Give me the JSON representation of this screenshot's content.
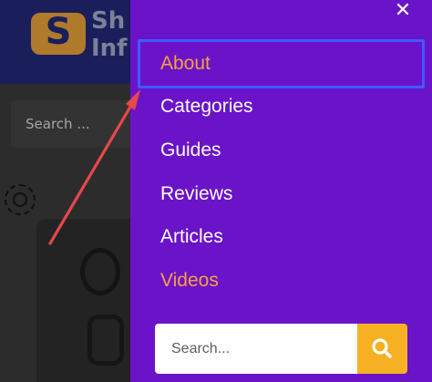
{
  "background": {
    "logo": {
      "mark_letter": "S",
      "text_line1": "Sh",
      "text_line2": "Inf"
    },
    "search": {
      "placeholder": "Search ..."
    }
  },
  "menu": {
    "close_label": "✕",
    "items": [
      {
        "label": "About",
        "highlighted": true
      },
      {
        "label": "Categories",
        "highlighted": false
      },
      {
        "label": "Guides",
        "highlighted": false
      },
      {
        "label": "Reviews",
        "highlighted": false
      },
      {
        "label": "Articles",
        "highlighted": false
      },
      {
        "label": "Videos",
        "highlighted": true
      }
    ],
    "search": {
      "placeholder": "Search...",
      "button_icon": "search-icon"
    }
  },
  "colors": {
    "panel": "#6b13c9",
    "highlight": "#f7a040",
    "focus_outline": "#3d5cff",
    "search_button": "#f6b024",
    "annotation_arrow": "#e8474b"
  }
}
